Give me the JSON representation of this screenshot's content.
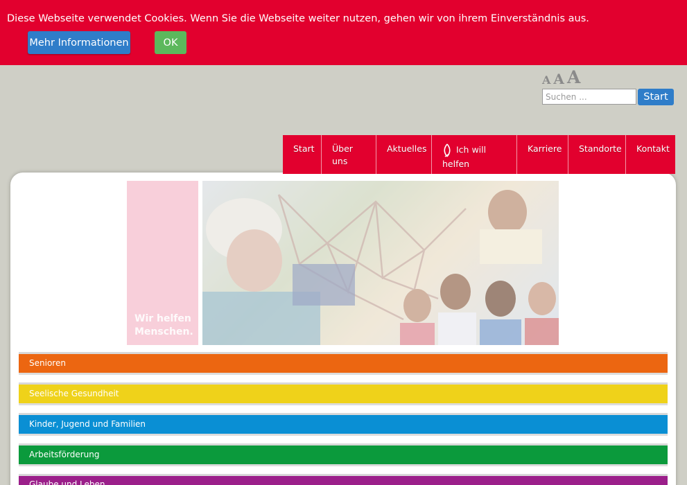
{
  "cookie": {
    "text": "Diese Webseite verwendet Cookies. Wenn Sie die Webseite weiter nutzen, gehen wir von ihrem Einverständnis aus.",
    "more_label": "Mehr Informationen",
    "ok_label": "OK"
  },
  "fontsize": {
    "small": "A",
    "medium": "A",
    "large": "A"
  },
  "search": {
    "placeholder": "Suchen ...",
    "button_label": "Start"
  },
  "nav": {
    "items": [
      {
        "label": "Start"
      },
      {
        "label": "Über uns"
      },
      {
        "label": "Aktuelles"
      },
      {
        "label": "Ich will helfen",
        "icon": "fish-icon"
      },
      {
        "label": "Karriere"
      },
      {
        "label": "Standorte"
      },
      {
        "label": "Kontakt"
      }
    ]
  },
  "hero": {
    "slogan_line1": "Wir helfen",
    "slogan_line2": "Menschen."
  },
  "categories": [
    {
      "label": "Senioren",
      "color": "#ec6611"
    },
    {
      "label": "Seelische Gesundheit",
      "color": "#efd21a"
    },
    {
      "label": "Kinder, Jugend und Familien",
      "color": "#0a8fd4"
    },
    {
      "label": "Arbeitsförderung",
      "color": "#0b9a3c"
    },
    {
      "label": "Glaube und Leben",
      "color": "#9b1f8a"
    }
  ],
  "colors": {
    "brand_red": "#e2002e",
    "button_blue": "#2f7dc9",
    "button_green": "#5cb85c"
  }
}
